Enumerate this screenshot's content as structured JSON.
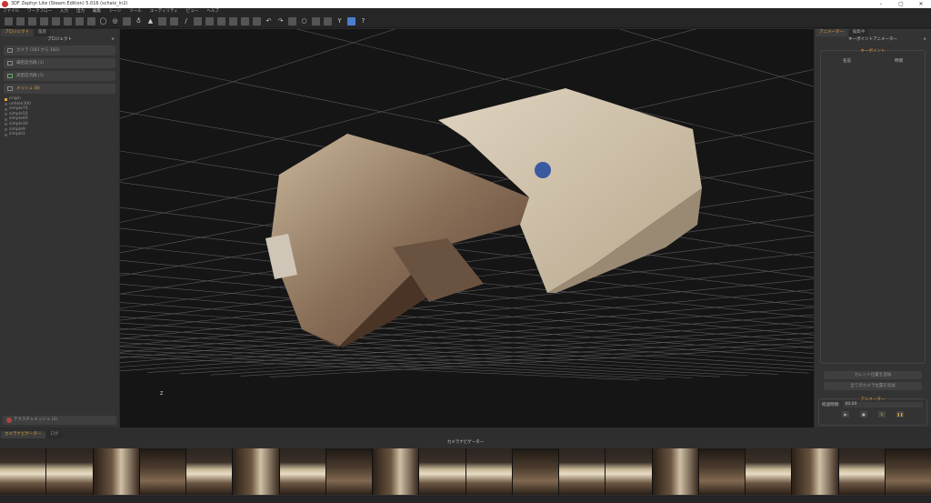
{
  "window": {
    "title": "3DF Zephyr Lite (Steam Edition) 5.016 (schatz_in2)",
    "controls": [
      "–",
      "▢",
      "✕"
    ]
  },
  "menu": [
    "ファイル",
    "ワークフロー",
    "入力",
    "出力",
    "編集",
    "シーン",
    "ツール",
    "ユーティリティ",
    "ビュー",
    "ヘルプ"
  ],
  "toolbar": {
    "icons": [
      "import-icon",
      "save-icon",
      "workflow-icon",
      "cube-icon",
      "cube2-icon",
      "mask-icon",
      "mask2-icon",
      "camera-icon",
      "orbit-icon",
      "pivot-icon",
      "pan-icon",
      "light-icon",
      "points-icon",
      "points-color-icon",
      "points-rgb-icon",
      "brush-icon",
      "select-icon",
      "dots-icon",
      "dots2-icon",
      "mesh-icon",
      "texture-icon",
      "grid-icon",
      "undo-icon",
      "redo-icon",
      "lasso-icon",
      "circle-icon",
      "transform-icon",
      "measure-icon",
      "filter-icon",
      "cube-view-icon",
      "help-icon"
    ]
  },
  "left": {
    "tabs": [
      "プロジェクト",
      "履歴"
    ],
    "title": "プロジェクト",
    "buttons": [
      "カメラ (183 から 182)",
      "疎密度点群 (1)",
      "高密度点群 (1)",
      "メッシュ (8)"
    ],
    "meshes": [
      "origin",
      "unhole300",
      "simple70",
      "simple50",
      "simple40",
      "simple30",
      "simple9",
      "simple1"
    ],
    "textured": "テクスチャメッシュ (3)"
  },
  "right": {
    "tabs": [
      "アニメーター",
      "編集中"
    ],
    "title": "キーポイントアニメーター",
    "keypoints_label": "キーポイント",
    "col_name": "名前",
    "col_time": "時間",
    "add_current": "カレント位置を追加",
    "add_all": "全てのカメラ位置を追加",
    "animator_label": "アニメーター",
    "duration_label": "経過時間:",
    "duration_value": "00:00"
  },
  "bottom": {
    "tabs": [
      "カメラナビゲーター",
      "ログ"
    ],
    "title": "カメラナビゲーター",
    "thumbnail_count": 20
  },
  "viewport": {
    "axis_label": "Z"
  },
  "colors": {
    "accent": "#e3a13a",
    "background": "#151515",
    "panel": "#333333"
  }
}
